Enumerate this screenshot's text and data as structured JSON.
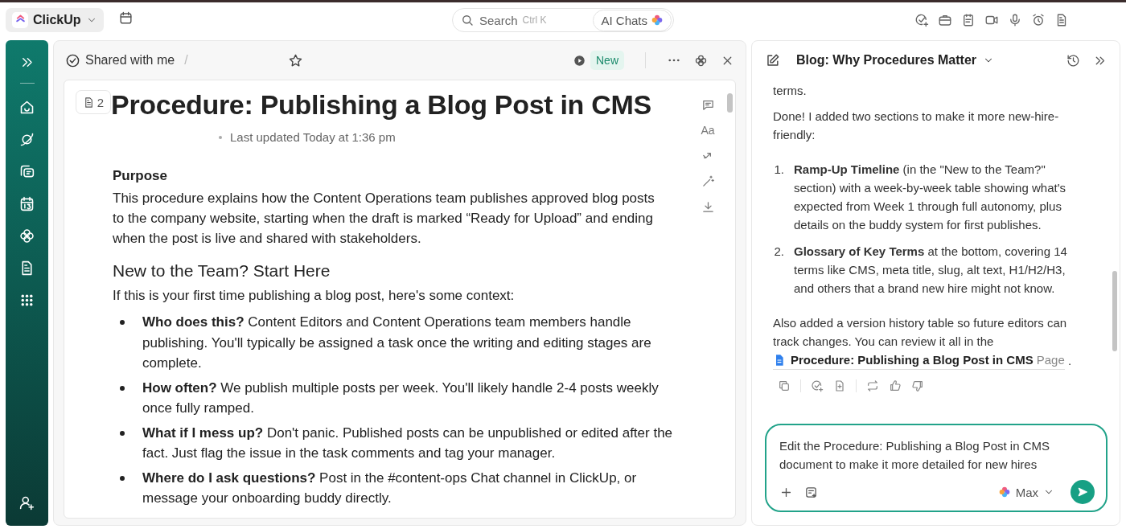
{
  "topbar": {
    "workspace": "ClickUp",
    "search_placeholder": "Search",
    "search_shortcut": "Ctrl K",
    "ai_button": "AI Chats"
  },
  "doc_header": {
    "breadcrumb": "Shared with me",
    "separator": "/",
    "status": "New"
  },
  "document": {
    "page_count": "2",
    "title": "Procedure: Publishing a Blog Post in CMS",
    "meta": "Last updated Today at 1:36 pm",
    "font_button": "Aa",
    "blocks": [
      {
        "kind": "label",
        "text": "Purpose"
      },
      {
        "kind": "paragraph",
        "text": "This procedure explains how the Content Operations team publishes approved blog posts to the company website, starting when the draft is marked “Ready for Upload” and ending when the post is live and shared with stakeholders."
      },
      {
        "kind": "heading",
        "text": "New to the Team? Start Here"
      },
      {
        "kind": "paragraph",
        "text": "If this is your first time publishing a blog post, here's some context:"
      },
      {
        "kind": "bullets",
        "items": [
          "**Who does this?** Content Editors and Content Operations team members handle publishing. You'll typically be assigned a task once the writing and editing stages are complete.",
          "**How often?** We publish multiple posts per week. You'll likely handle 2-4 posts weekly once fully ramped.",
          "**What if I mess up?** Don't panic. Published posts can be unpublished or edited after the fact. Just flag the issue in the task comments and tag your manager.",
          "**Where do I ask questions?** Post in the #content-ops Chat channel in ClickUp, or message your onboarding buddy directly."
        ]
      }
    ]
  },
  "chat": {
    "title": "Blog: Why Procedures Matter",
    "messages": [
      {
        "kind": "text",
        "text": "terms."
      },
      {
        "kind": "text",
        "text": "Done! I added two sections to make it more new-hire-friendly:"
      },
      {
        "kind": "numbered",
        "items": [
          {
            "number": "1.",
            "text": "**Ramp-Up Timeline** (in the \"New to the Team?\" section) with a week-by-week table showing what's expected from Week 1 through full autonomy, plus details on the buddy system for first publishes."
          },
          {
            "number": "2.",
            "text": "**Glossary of Key Terms** at the bottom, covering 14 terms like CMS, meta title, slug, alt text, H1/H2/H3, and others that a brand new hire might not know."
          }
        ]
      },
      {
        "kind": "link-text",
        "text": "Also added a version history table so future editors can track changes. You can review it all in the",
        "link": "Procedure: Publishing a Blog Post in CMS",
        "link_type": "Page",
        "after": "."
      }
    ],
    "input": {
      "value": "Edit the Procedure: Publishing a Blog Post in CMS document to make it more detailed for new hires",
      "model": "Max"
    }
  }
}
